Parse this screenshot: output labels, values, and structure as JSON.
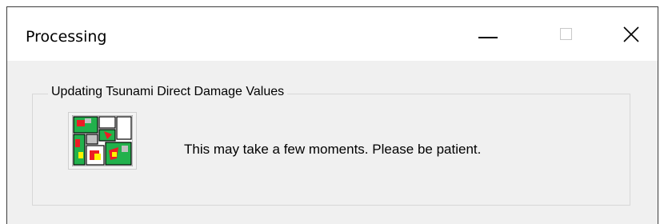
{
  "window": {
    "title": "Processing",
    "controls": {
      "minimize_icon": "minimize-icon",
      "maximize_icon": "maximize-icon",
      "close_icon": "close-icon"
    }
  },
  "group": {
    "label": "Updating Tsunami Direct Damage Values"
  },
  "content": {
    "icon": "processing-map-icon",
    "message": "This may take a few moments. Please be patient."
  },
  "colors": {
    "titlebar": "#ffffff",
    "window_bg": "#f0f0f0",
    "groupbox_border": "#d7d7d7",
    "icon_green": "#22b14c",
    "icon_red": "#ed1c24",
    "icon_yellow": "#fff200"
  }
}
